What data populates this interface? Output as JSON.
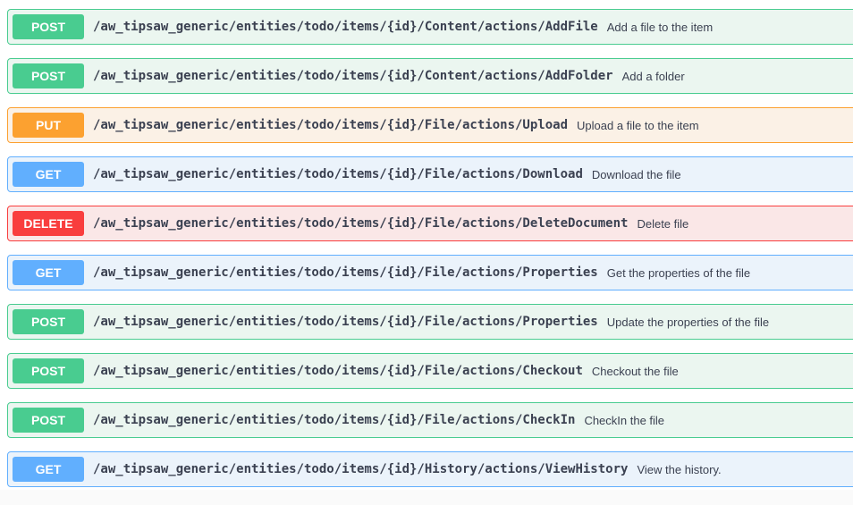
{
  "operations": [
    {
      "method": "POST",
      "path": "/aw_tipsaw_generic/entities/todo/items/{id}/Content/actions/AddFile",
      "summary": "Add a file to the item"
    },
    {
      "method": "POST",
      "path": "/aw_tipsaw_generic/entities/todo/items/{id}/Content/actions/AddFolder",
      "summary": "Add a folder"
    },
    {
      "method": "PUT",
      "path": "/aw_tipsaw_generic/entities/todo/items/{id}/File/actions/Upload",
      "summary": "Upload a file to the item"
    },
    {
      "method": "GET",
      "path": "/aw_tipsaw_generic/entities/todo/items/{id}/File/actions/Download",
      "summary": "Download the file"
    },
    {
      "method": "DELETE",
      "path": "/aw_tipsaw_generic/entities/todo/items/{id}/File/actions/DeleteDocument",
      "summary": "Delete file"
    },
    {
      "method": "GET",
      "path": "/aw_tipsaw_generic/entities/todo/items/{id}/File/actions/Properties",
      "summary": "Get the properties of the file"
    },
    {
      "method": "POST",
      "path": "/aw_tipsaw_generic/entities/todo/items/{id}/File/actions/Properties",
      "summary": "Update the properties of the file"
    },
    {
      "method": "POST",
      "path": "/aw_tipsaw_generic/entities/todo/items/{id}/File/actions/Checkout",
      "summary": "Checkout the file"
    },
    {
      "method": "POST",
      "path": "/aw_tipsaw_generic/entities/todo/items/{id}/File/actions/CheckIn",
      "summary": "CheckIn the file"
    },
    {
      "method": "GET",
      "path": "/aw_tipsaw_generic/entities/todo/items/{id}/History/actions/ViewHistory",
      "summary": "View the history."
    }
  ],
  "colors": {
    "post": "#49cc90",
    "put": "#fca130",
    "get": "#61affe",
    "delete": "#f93e3e",
    "text": "#3b4151"
  }
}
